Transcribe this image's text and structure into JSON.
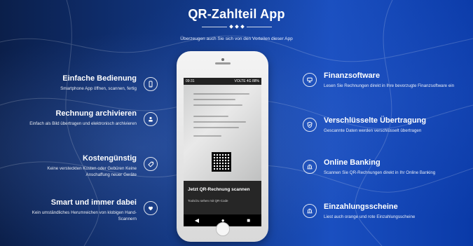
{
  "header": {
    "title": "QR-Zahlteil App",
    "subtitle": "Überzeugen auch Sie sich von den Vorteilen dieser App"
  },
  "features_left": [
    {
      "title": "Einfache Bedienung",
      "desc": "Smartphone App öffnen, scannen, fertig",
      "icon": "smartphone-icon"
    },
    {
      "title": "Rechnung archivieren",
      "desc": "Einfach als Bild übertragen und elektronisch archivieren",
      "icon": "archive-user-icon"
    },
    {
      "title": "Kostengünstig",
      "desc": "Keine versteckten Kosten oder Gebüren Keine Anschaffung neuer Geräte",
      "icon": "tag-icon"
    },
    {
      "title": "Smart und immer dabei",
      "desc": "Kein umständliches Herumreichen von klobigen Hand-Scannern",
      "icon": "heart-icon"
    }
  ],
  "features_right": [
    {
      "title": "Finanzsoftware",
      "desc": "Lesen Sie Rechnungen direkt in Ihre bevorzugte Finanzsoftware ein",
      "icon": "monitor-icon"
    },
    {
      "title": "Verschlüsselte Übertragung",
      "desc": "Gescannte Daten werden verschlüsselt übertragen",
      "icon": "shield-icon"
    },
    {
      "title": "Online Banking",
      "desc": "Scannen Sie QR-Rechnungen direkt in Ihr Online Banking",
      "icon": "bank-icon"
    },
    {
      "title": "Einzahlungsscheine",
      "desc": "Liest auch orange und rote Einzahlungsscheine",
      "icon": "bank-icon"
    }
  ],
  "phone": {
    "status_time": "09:31",
    "status_right": "VOLTE 4G 88%",
    "scan_title": "Jetzt QR-Rechnung scannen",
    "scan_hint": "Tools/zu sehen mit QR-Code",
    "nav_back": "◀",
    "nav_home": "●",
    "nav_recent": "■"
  },
  "colors": {
    "bg_dark": "#0b1f4a",
    "bg_blue": "#1a4fc0",
    "text": "#ffffff"
  }
}
